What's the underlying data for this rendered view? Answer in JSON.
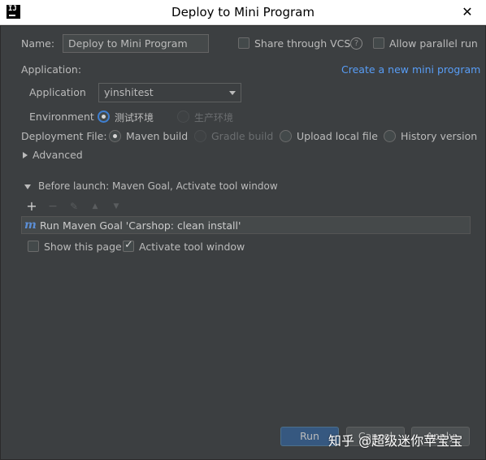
{
  "window": {
    "title": "Deploy to Mini Program",
    "app_icon_text": "IJ",
    "close_glyph": "✕"
  },
  "form": {
    "name_label": "Name:",
    "name_value": "Deploy to Mini Program",
    "share_vcs_label": "Share through VCS",
    "share_vcs_checked": false,
    "allow_parallel_label": "Allow parallel run",
    "allow_parallel_checked": false,
    "help_glyph": "?"
  },
  "application_section": {
    "header": "Application:",
    "create_link": "Create a new mini program",
    "application_label": "Application",
    "application_value": "yinshitest",
    "environment_label": "Environment",
    "environment_options": [
      {
        "label": "测试环境",
        "selected": true,
        "enabled": true
      },
      {
        "label": "生产环境",
        "selected": false,
        "enabled": false
      }
    ]
  },
  "deployment": {
    "label": "Deployment File:",
    "options": [
      {
        "label": "Maven build",
        "selected": true,
        "enabled": true
      },
      {
        "label": "Gradle build",
        "selected": false,
        "enabled": false
      },
      {
        "label": "Upload local file",
        "selected": false,
        "enabled": true
      },
      {
        "label": "History version",
        "selected": false,
        "enabled": true
      }
    ]
  },
  "advanced": {
    "label": "Advanced"
  },
  "before_launch": {
    "header": "Before launch: Maven Goal, Activate tool window",
    "toolbar": [
      "add-icon",
      "remove-icon",
      "edit-icon",
      "move-up-icon",
      "move-down-icon"
    ],
    "toolbar_glyphs": [
      "+",
      "−",
      "✎",
      "▲",
      "▼"
    ],
    "tasks": [
      {
        "icon_glyph": "m",
        "text": "Run Maven Goal 'Carshop: clean install'"
      }
    ],
    "show_page_label": "Show this page",
    "show_page_checked": false,
    "activate_tool_label": "Activate tool window",
    "activate_tool_checked": true
  },
  "footer": {
    "run_label": "Run",
    "cancel_label": "Cancel",
    "apply_label": "Apply"
  },
  "watermark": "知乎 @超级迷你苹宝宝",
  "colors": {
    "panel_bg": "#3c3f41",
    "link": "#589df6",
    "primary_button": "#365880",
    "radio_selected_border": "#3f7fd1"
  }
}
